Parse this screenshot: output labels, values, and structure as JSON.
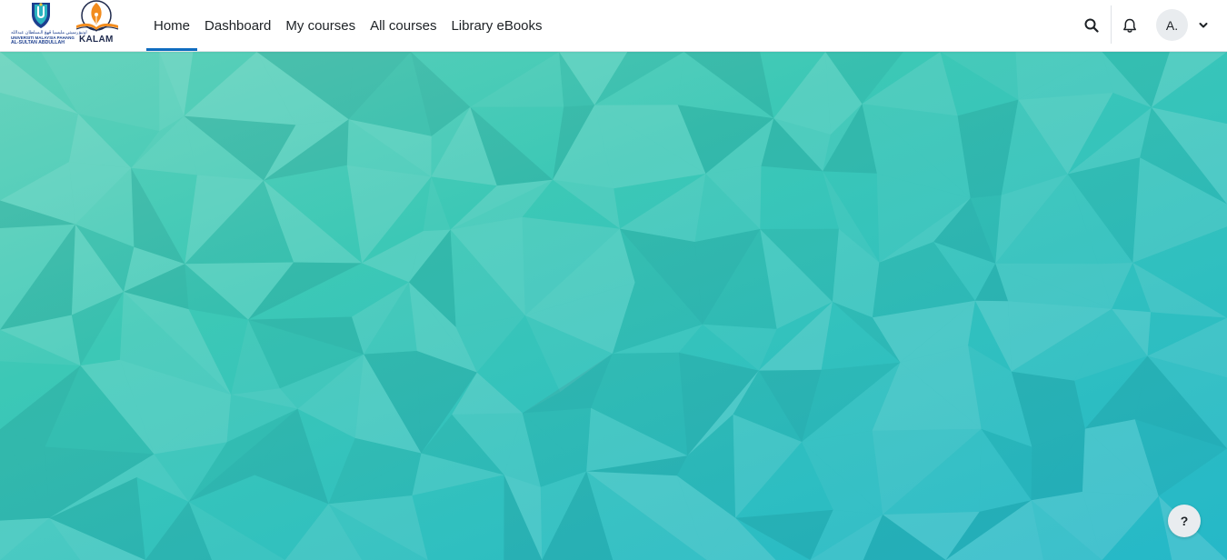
{
  "branding": {
    "university_arabic": "اونيۏرسيتي مليسيا ڤهڠ الـسلطان عبدالله",
    "university_line1": "UNIVERSITI MALAYSIA PAHANG",
    "university_line2": "AL-SULTAN ABDULLAH",
    "university_mark": "U",
    "app_logo_text": "KALAM",
    "colors": {
      "university_blue": "#1d3f8f",
      "kalam_orange": "#f28c1e",
      "kalam_navy": "#1f2a4d"
    }
  },
  "nav": {
    "items": [
      {
        "label": "Home",
        "active": true
      },
      {
        "label": "Dashboard",
        "active": false
      },
      {
        "label": "My courses",
        "active": false
      },
      {
        "label": "All courses",
        "active": false
      },
      {
        "label": "Library eBooks",
        "active": false
      }
    ],
    "accent_color": "#0f6cbf"
  },
  "user_menu": {
    "avatar_initials": "A.",
    "search_icon": "search-icon",
    "notification_icon": "bell-icon",
    "caret_icon": "chevron-down-icon"
  },
  "hero": {
    "background": "low-poly teal geometric pattern",
    "colors": {
      "top_left": "#5fd1b9",
      "middle": "#34c4bb",
      "bottom_right": "#25b8c8"
    }
  },
  "help_button": {
    "label": "?"
  }
}
